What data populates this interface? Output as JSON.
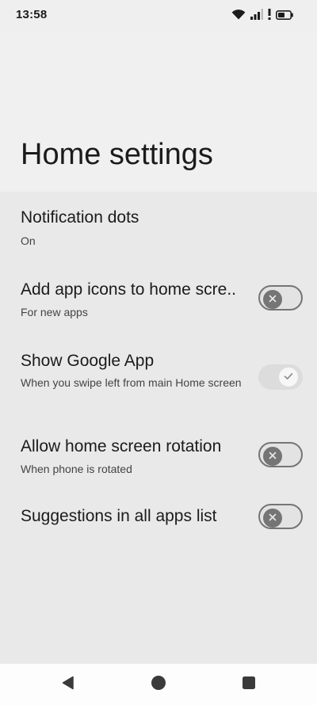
{
  "status_bar": {
    "time": "13:58",
    "icons": [
      "wifi-icon",
      "cell-signal-icon",
      "alert-icon",
      "battery-icon"
    ]
  },
  "header": {
    "title": "Home settings"
  },
  "settings": [
    {
      "title": "Notification dots",
      "subtitle": "On",
      "toggle": null
    },
    {
      "title": "Add app icons to home scre..",
      "subtitle": "For new apps",
      "toggle": false
    },
    {
      "title": "Show Google App",
      "subtitle": "When you swipe left from main Home screen",
      "toggle": true
    },
    {
      "title": "Allow home screen rotation",
      "subtitle": "When phone is rotated",
      "toggle": false
    },
    {
      "title": "Suggestions in all apps list",
      "subtitle": "",
      "toggle": false
    }
  ],
  "nav_bar": {
    "icons": [
      "back-icon",
      "home-icon",
      "recents-icon"
    ]
  },
  "colors": {
    "background": "#efefef",
    "list_background": "#e9e9e9",
    "toggle_off_track": "#757575",
    "nav_bar": "#fdfdfd"
  }
}
